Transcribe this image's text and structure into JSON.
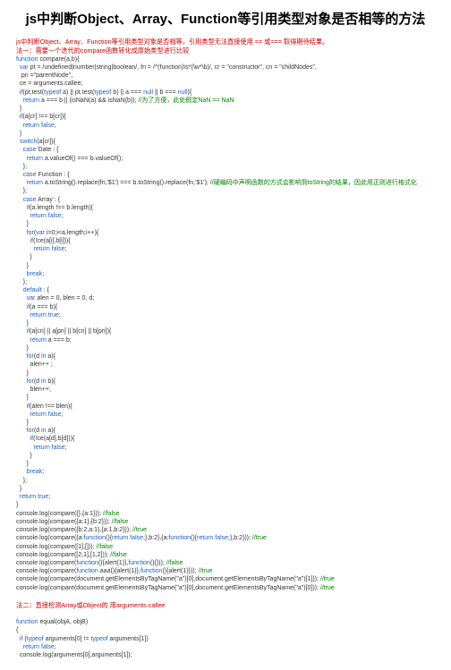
{
  "title": "js中判断Object、Array、Function等引用类型对象是否相等的方法",
  "intro": "js中判断Object、Array、Function等引用类型对象是否相等，引用类型无法直接使用 == 或=== 取得期待结果。",
  "method1_title": "法一：需要一个迭代的compare函数转化成原始类型进行比较",
  "code1": {
    "l1a": "function",
    "l1b": " compare(a,b){",
    "l2a": "  var",
    "l2b": " pt = /undefined|number|string|boolean/, fn = /^(function)\\s*(\\w*\\b)/, cr = \"constructor\", cn = \"childNodes\",",
    "l3": "   pn =\"parentNode\",",
    "l4": "  ce = arguments.callee;",
    "l5a": "  if",
    "l5b": "(pt.test(",
    "l5c": "typeof",
    "l5d": " a) || pt.test(",
    "l5e": "typeof",
    "l5f": " b) || a === ",
    "l5g": "null",
    "l5h": " || b === ",
    "l5i": "null",
    "l5j": "){",
    "l6a": "    return",
    "l6b": " a === b || (isNaN(a) && isNaN(b)); ",
    "l6c": "//为了方便，此处假定NaN == NaN",
    "l7": "  }",
    "l8a": "  if",
    "l8b": "(a[cr] !== b[cr]){",
    "l9a": "    return false",
    "l9b": ";",
    "l10": "  }",
    "l11a": "  switch",
    "l11b": "(a[cr]){",
    "l12a": "    case",
    "l12b": " Date : {",
    "l13a": "      return",
    "l13b": " a.valueOf() === b.valueOf();",
    "l14": "    };",
    "l15a": "    case",
    "l15b": " Function : {",
    "l16a": "      return",
    "l16b": " a.toString().replace(fn,'$1') === b.toString().replace(fn,'$1'); ",
    "l16c": "//硬编码中声明函数的方式会影响到toString的结果，因此用正则进行格式化",
    "l17": "    };",
    "l18a": "    case",
    "l18b": " Array : {",
    "l19a": "      if",
    "l19b": "(a.length !== b.length){",
    "l20a": "        return false",
    "l20b": ";",
    "l21": "      }",
    "l22a": "      for",
    "l22b": "(",
    "l22c": "var",
    "l22d": " i=0;i<a.length;i++){",
    "l23a": "        if",
    "l23b": "(!ce(a[i],b[i])){",
    "l24a": "          return false",
    "l24b": ";",
    "l25": "        }",
    "l26": "      }",
    "l27a": "      break",
    "l27b": ";",
    "l28": "    };",
    "l29a": "    default",
    "l29b": " : {",
    "l30a": "      var",
    "l30b": " alen = 0, blen = 0, d;",
    "l31a": "      if",
    "l31b": "(a === b){",
    "l32a": "        return true",
    "l32b": ";",
    "l33": "      }",
    "l34a": "      if",
    "l34b": "(a[cn] || a[pn] || b[cn] || b[pn]){",
    "l35a": "        return",
    "l35b": " a === b;",
    "l36": "      }",
    "l37a": "      for",
    "l37b": "(d ",
    "l37c": "in",
    "l37d": " a){",
    "l38": "        alen++ ;",
    "l39": "      }",
    "l40a": "      for",
    "l40b": "(d ",
    "l40c": "in",
    "l40d": " b){",
    "l41": "        blen++;",
    "l42": "      }",
    "l43a": "      if",
    "l43b": "(alen !== blen){",
    "l44a": "        return false",
    "l44b": ";",
    "l45": "      }",
    "l46a": "      for",
    "l46b": "(d ",
    "l46c": "in",
    "l46d": " a){",
    "l47a": "        if",
    "l47b": "(!ce(a[d],b[d])){",
    "l48a": "          return false",
    "l48b": ";",
    "l49": "        }",
    "l50": "      }",
    "l51a": "      break",
    "l51b": ";",
    "l52": "    };",
    "l53": "  }",
    "l54a": "  return true",
    "l54b": ";",
    "l55": "}",
    "c1a": "console.log(compare({},{a:1})); ",
    "c1b": "//false",
    "c2a": "console.log(compare({a:1},{b:2})); ",
    "c2b": "//false",
    "c3a": "console.log(compare({b:2,a:1},{a:1,b:2})); ",
    "c3b": "//true",
    "c4a": "console.log(compare({a:",
    "c4b": "function",
    "c4c": "(){",
    "c4d": "return false",
    "c4e": ";},b:2},{a:",
    "c4f": "function",
    "c4g": "(){",
    "c4h": "return false",
    "c4i": ";},b:2})); ",
    "c4j": "//true",
    "c5a": "console.log(compare([1],[])); ",
    "c5b": "//false",
    "c6a": "console.log(compare([2,1],[1,2])); ",
    "c6b": "//false",
    "c7a": "console.log(compare(",
    "c7b": "function",
    "c7c": "(){alert(1)},",
    "c7d": "function",
    "c7e": "(){})); ",
    "c7f": "//false",
    "c8a": "console.log(compare(",
    "c8b": "function",
    "c8c": " aaa(){alert(1)},",
    "c8d": "function",
    "c8e": "(){alert(1)})); ",
    "c8f": "//true",
    "c9a": "console.log(compare(document.getElementsByTagName(\"a\")[0],document.getElementsByTagName(\"a\")[1])); ",
    "c9b": "//true",
    "c10a": "console.log(compare(document.getElementsByTagName(\"a\")[0],document.getElementsByTagName(\"a\")[0])); ",
    "c10b": "//true"
  },
  "method2_title": "法二：直接检测Array或Object的  用arguments.callee",
  "code2": {
    "l1a": "function",
    "l1b": " equal(objA, objB)",
    "l2": "{",
    "l3a": "  if",
    "l3b": " (",
    "l3c": "typeof",
    "l3d": " arguments[0] != ",
    "l3e": "typeof",
    "l3f": " arguments[1])",
    "l4a": "    return false",
    "l4b": ";",
    "l5": "  console.log(arguments[0],arguments[1]);"
  }
}
